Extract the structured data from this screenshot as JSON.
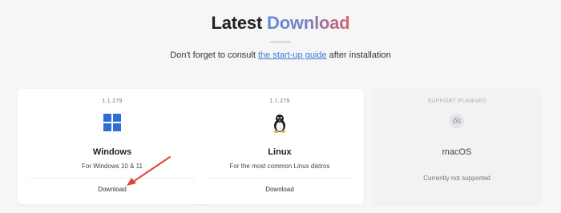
{
  "header": {
    "title_plain": "Latest",
    "title_accent": "Download",
    "subtitle_before": "Don't forget to consult",
    "subtitle_link": "the start-up guide",
    "subtitle_after": "after installation"
  },
  "cards": [
    {
      "os": "Windows",
      "version": "1.1.279",
      "description": "For Windows 10 & 11",
      "action": "Download",
      "icon": "windows-logo-icon"
    },
    {
      "os": "Linux",
      "version": "1.1.279",
      "description": "For the most common Linux distros",
      "action": "Download",
      "icon": "linux-tux-icon"
    },
    {
      "os": "macOS",
      "status": "SUPPORT PLANNED",
      "note": "Currently not supported",
      "icon": "macos-badge-icon",
      "icon_text": "OS",
      "icon_small_text": "mac"
    }
  ],
  "colors": {
    "page_bg": "#f6f6f7",
    "link": "#3a7bd5",
    "windows_blue": "#2d6fd1",
    "annotation_arrow": "#e0453a"
  }
}
